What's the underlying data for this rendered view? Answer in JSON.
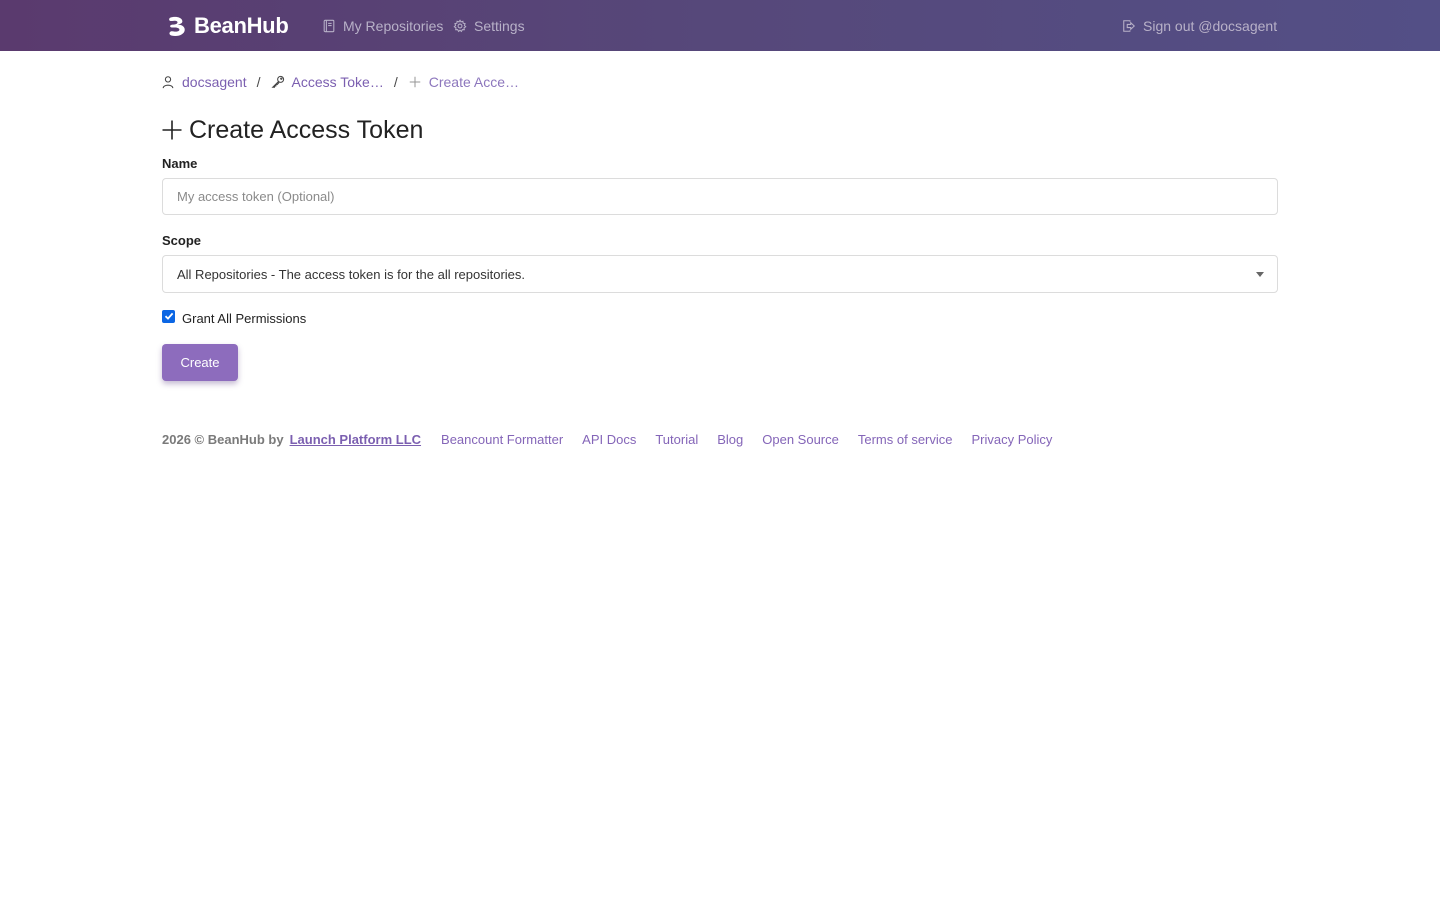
{
  "navbar": {
    "brand": "BeanHub",
    "links": [
      {
        "label": "My Repositories",
        "icon": "book-icon"
      },
      {
        "label": "Settings",
        "icon": "gear-icon"
      }
    ],
    "signout": {
      "label": "Sign out @docsagent",
      "icon": "sign-out-icon"
    }
  },
  "breadcrumb": [
    {
      "label": "docsagent",
      "icon": "user-icon"
    },
    {
      "label": "Access Toke…",
      "icon": "key-icon"
    },
    {
      "label": "Create Acce…",
      "icon": "plus-icon"
    }
  ],
  "breadcrumb_separator": "/",
  "page": {
    "title": "Create Access Token",
    "title_icon": "plus-icon"
  },
  "form": {
    "name_label": "Name",
    "name_placeholder": "My access token (Optional)",
    "name_value": "",
    "scope_label": "Scope",
    "scope_value": "All Repositories - The access token is for the all repositories.",
    "grant_all_label": "Grant All Permissions",
    "grant_all_checked": true,
    "submit_label": "Create"
  },
  "footer": {
    "copyright": "2026 © BeanHub by",
    "company": "Launch Platform LLC",
    "links": [
      "Beancount Formatter",
      "API Docs",
      "Tutorial",
      "Blog",
      "Open Source",
      "Terms of service",
      "Privacy Policy"
    ]
  },
  "colors": {
    "navbar_start": "#5a3a6e",
    "navbar_end": "#534f86",
    "accent": "#8d6cbd",
    "link": "#7b5fb0",
    "checkbox": "#0b66e4"
  }
}
